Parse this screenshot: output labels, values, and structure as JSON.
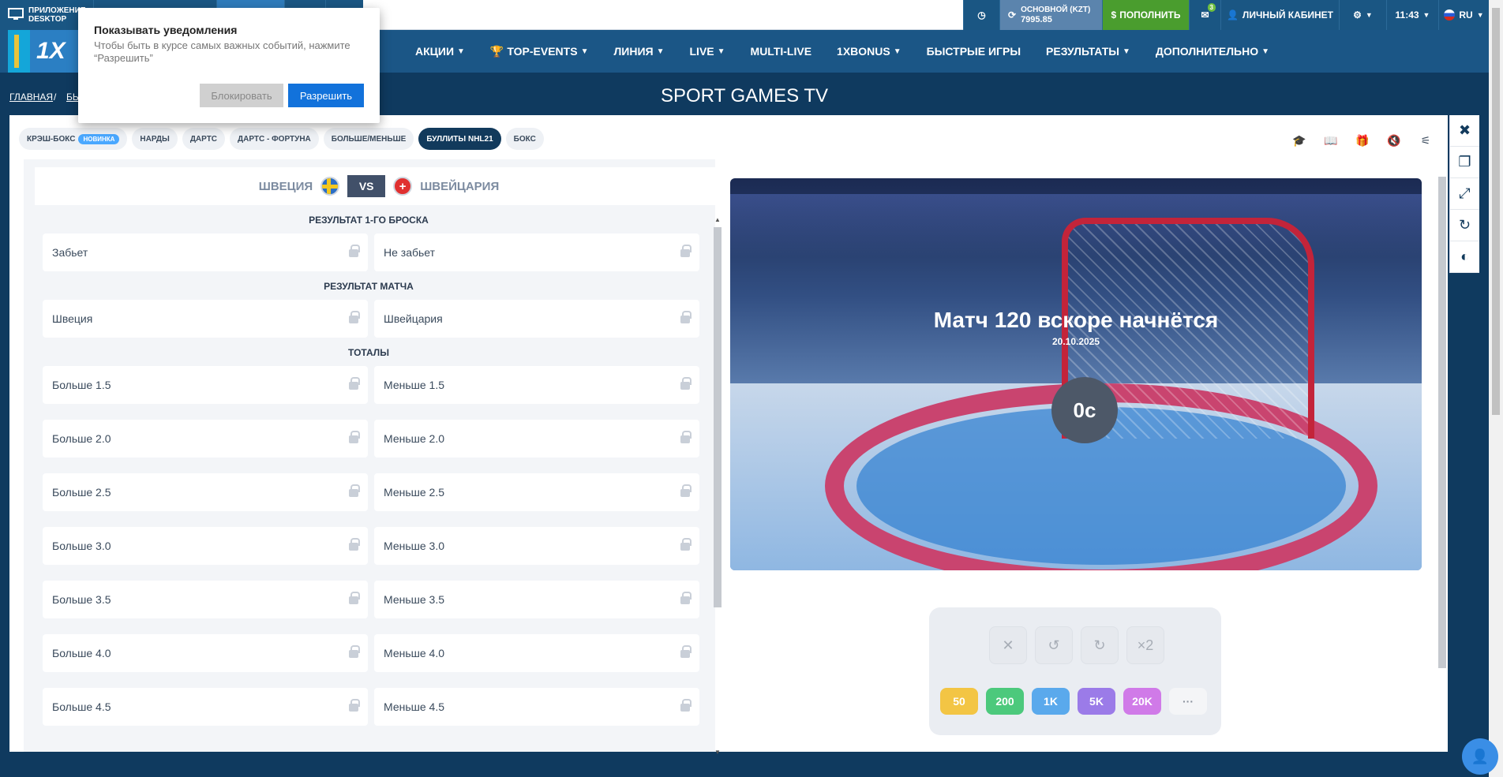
{
  "topbar": {
    "app_label": "ПРИЛОЖЕНИЕ",
    "app_sublabel": "DESKTOP",
    "account_label": "ОСНОВНОЙ (KZT)",
    "account_balance": "7995.85",
    "deposit_label": "ПОПОЛНИТЬ",
    "messages_count": "3",
    "cabinet_label": "ЛИЧНЫЙ КАБИНЕТ",
    "time": "11:43",
    "language": "RU"
  },
  "nav": {
    "logo_text": "1X",
    "items": [
      {
        "label": "АКЦИИ"
      },
      {
        "label": "TOP-EVENTS"
      },
      {
        "label": "ЛИНИЯ"
      },
      {
        "label": "LIVE"
      },
      {
        "label": "MULTI-LIVE"
      },
      {
        "label": "1XBONUS"
      },
      {
        "label": "БЫСТРЫЕ ИГРЫ"
      },
      {
        "label": "РЕЗУЛЬТАТЫ"
      },
      {
        "label": "ДОПОЛНИТЕЛЬНО"
      }
    ]
  },
  "breadcrumb": {
    "home": "ГЛАВНАЯ",
    "sep": "/",
    "current": "БЫ"
  },
  "page_title": "SPORT GAMES TV",
  "tabs": [
    {
      "label": "КРЭШ-БОКС",
      "badge": "НОВИНКА"
    },
    {
      "label": "НАРДЫ"
    },
    {
      "label": "ДАРТС"
    },
    {
      "label": "ДАРТС - ФОРТУНА"
    },
    {
      "label": "БОЛЬШЕ/МЕНЬШЕ"
    },
    {
      "label": "БУЛЛИТЫ NHL21"
    },
    {
      "label": "БОКС"
    }
  ],
  "match": {
    "team1": "ШВЕЦИЯ",
    "vs": "VS",
    "team2": "ШВЕЙЦАРИЯ",
    "team2_flag_glyph": "+"
  },
  "markets": {
    "first_shot_title": "РЕЗУЛЬТАТ 1-ГО БРОСКА",
    "first_shot": [
      "Забьет",
      "Не забьет"
    ],
    "match_result_title": "РЕЗУЛЬТАТ МАТЧА",
    "match_result": [
      "Швеция",
      "Швейцария"
    ],
    "totals_title": "ТОТАЛЫ",
    "totals": [
      [
        "Больше 1.5",
        "Меньше 1.5"
      ],
      [
        "Больше 2.0",
        "Меньше 2.0"
      ],
      [
        "Больше 2.5",
        "Меньше 2.5"
      ],
      [
        "Больше 3.0",
        "Меньше 3.0"
      ],
      [
        "Больше 3.5",
        "Меньше 3.5"
      ],
      [
        "Больше 4.0",
        "Меньше 4.0"
      ],
      [
        "Больше 4.5",
        "Меньше 4.5"
      ]
    ]
  },
  "video": {
    "headline": "Матч 120 вскоре начнётся",
    "date": "20.10.2025",
    "timer": "0с"
  },
  "controls": {
    "buttons": [
      "✕",
      "↺",
      "↻",
      "×2"
    ],
    "chips": [
      {
        "label": "50",
        "color": "#f3c544"
      },
      {
        "label": "200",
        "color": "#4cc97c"
      },
      {
        "label": "1K",
        "color": "#5aa9ec"
      },
      {
        "label": "5K",
        "color": "#9b7be8"
      },
      {
        "label": "20K",
        "color": "#d07ae8"
      },
      {
        "label": "···",
        "color": "#f4f5f7"
      }
    ]
  },
  "notification": {
    "title": "Показывать уведомления",
    "text": "Чтобы быть в курсе самых важных событий, нажмите “Разрешить”",
    "block_label": "Блокировать",
    "allow_label": "Разрешить"
  },
  "colors": {
    "nav_bg": "#1b5686",
    "deposit_bg": "#4a9d2e",
    "accent_blue": "#1272db",
    "active_tab": "#123a5c"
  }
}
